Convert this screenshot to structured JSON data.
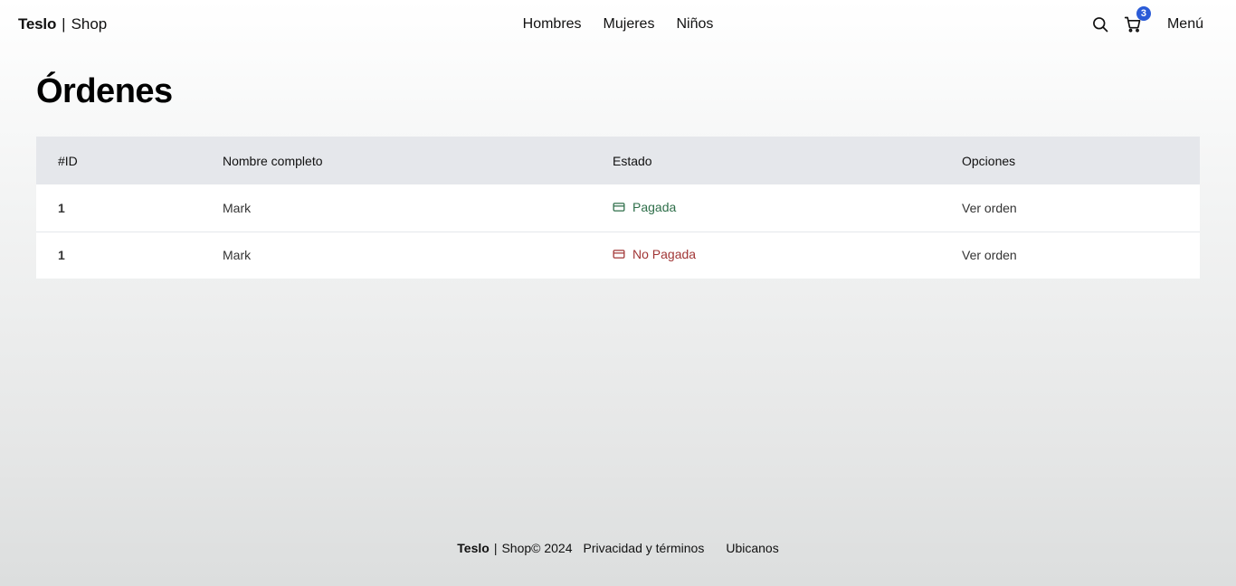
{
  "header": {
    "brand_name": "Teslo",
    "brand_sep": "|",
    "brand_shop": "Shop",
    "nav": [
      {
        "label": "Hombres"
      },
      {
        "label": "Mujeres"
      },
      {
        "label": "Niños"
      }
    ],
    "search_icon": "search-icon",
    "cart_icon": "shopping-cart-icon",
    "cart_count": "3",
    "menu_label": "Menú",
    "accent_color": "#2a5bd7"
  },
  "main": {
    "title": "Órdenes",
    "table": {
      "columns": [
        "#ID",
        "Nombre completo",
        "Estado",
        "Opciones"
      ],
      "rows": [
        {
          "id": "1",
          "name": "Mark",
          "status": "Pagada",
          "status_kind": "paid",
          "action": "Ver orden"
        },
        {
          "id": "1",
          "name": "Mark",
          "status": "No Pagada",
          "status_kind": "unpaid",
          "action": "Ver orden"
        }
      ],
      "status_icon": "credit-card-icon",
      "paid_color": "#2f6f4a",
      "unpaid_color": "#a13636"
    }
  },
  "footer": {
    "brand_name": "Teslo",
    "brand_sep": "|",
    "brand_shop": "Shop",
    "copyright": "© 2024",
    "privacy_label": "Privacidad y términos",
    "location_label": "Ubicanos"
  }
}
